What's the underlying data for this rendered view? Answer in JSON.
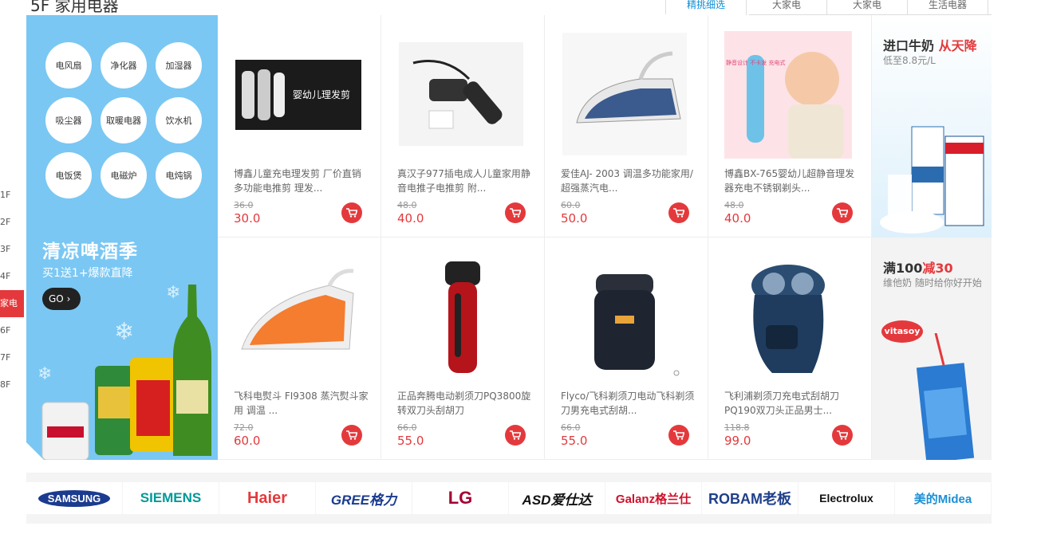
{
  "floor": {
    "title": "5F 家用电器",
    "tabs": [
      {
        "label": "精挑细选",
        "active": true
      },
      {
        "label": "大家电"
      },
      {
        "label": "大家电"
      },
      {
        "label": "生活电器"
      }
    ]
  },
  "elevator": [
    "1F",
    "2F",
    "3F",
    "4F",
    "家电",
    "6F",
    "7F",
    "8F"
  ],
  "categories": [
    "电风扇",
    "净化器",
    "加湿器",
    "吸尘器",
    "取暖电器",
    "饮水机",
    "电饭煲",
    "电磁炉",
    "电炖锅"
  ],
  "promo": {
    "title": "清凉啤酒季",
    "subtitle": "买1送1+爆款直降",
    "go": "GO"
  },
  "products": [
    {
      "name": "博鑫儿童充电理发剪 厂价直销多功能电推剪 理发...",
      "old_price": "36.0",
      "price": "30.0",
      "img_text": "婴幼儿理发剪"
    },
    {
      "name": "真汉子977插电成人儿童家用静音电推子电推剪 附...",
      "old_price": "48.0",
      "price": "40.0"
    },
    {
      "name": "爱佳AJ- 2003 调温多功能家用/超强蒸汽电...",
      "old_price": "60.0",
      "price": "50.0"
    },
    {
      "name": "博鑫BX-765婴幼儿超静音理发器充电不锈钢剃头...",
      "old_price": "48.0",
      "price": "40.0",
      "img_text": "静音设计 不卡发 充电式"
    },
    {
      "name": "飞科电熨斗 FI9308 蒸汽熨斗家用 调温 ...",
      "old_price": "72.0",
      "price": "60.0"
    },
    {
      "name": "正品奔腾电动剃须刀PQ3800旋转双刀头刮胡刀",
      "old_price": "66.0",
      "price": "55.0"
    },
    {
      "name": "Flyco/飞科剃须刀电动飞科剃须刀男充电式刮胡...",
      "old_price": "66.0",
      "price": "55.0"
    },
    {
      "name": "飞利浦剃须刀充电式刮胡刀PQ190双刀头正品男士...",
      "old_price": "118.8",
      "price": "99.0"
    }
  ],
  "ads": [
    {
      "title_a": "进口牛奶 ",
      "title_b": "从天降",
      "subtitle": "低至8.8元/L"
    },
    {
      "title_a": "满100",
      "title_b": "减30",
      "subtitle": "维他奶 随时给你好开始",
      "brand": "vitasoy"
    }
  ],
  "brands": [
    "SAMSUNG",
    "SIEMENS",
    "Haier",
    "GREE格力",
    "LG",
    "ASD爱仕达",
    "Galanz格兰仕",
    "ROBAM老板",
    "Electrolux",
    "美的Midea"
  ],
  "colors": {
    "accent": "#e4393c",
    "panel": "#7ac7f3",
    "tab_active": "#0e8ed6"
  }
}
